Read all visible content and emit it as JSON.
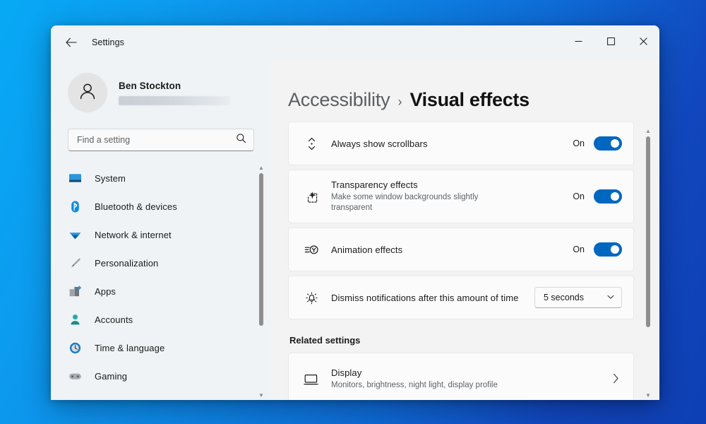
{
  "window": {
    "title": "Settings",
    "back_icon": "back-arrow-icon",
    "controls": {
      "minimize": "minimize-icon",
      "maximize": "maximize-icon",
      "close": "close-icon"
    }
  },
  "sidebar": {
    "profile": {
      "name": "Ben Stockton",
      "email_redacted": true,
      "avatar_icon": "person-icon"
    },
    "search": {
      "placeholder": "Find a setting",
      "value": "",
      "icon": "search-icon"
    },
    "items": [
      {
        "label": "System",
        "icon": "monitor-icon"
      },
      {
        "label": "Bluetooth & devices",
        "icon": "bluetooth-icon"
      },
      {
        "label": "Network & internet",
        "icon": "wifi-icon"
      },
      {
        "label": "Personalization",
        "icon": "paintbrush-icon"
      },
      {
        "label": "Apps",
        "icon": "apps-icon"
      },
      {
        "label": "Accounts",
        "icon": "account-icon"
      },
      {
        "label": "Time & language",
        "icon": "clock-icon"
      },
      {
        "label": "Gaming",
        "icon": "gamepad-icon"
      }
    ],
    "scrollbar": {
      "thumb_top_pct": 0,
      "thumb_height_pct": 70
    }
  },
  "main": {
    "breadcrumb": {
      "parent": "Accessibility",
      "separator": "›",
      "current": "Visual effects"
    },
    "settings": [
      {
        "title": "Always show scrollbars",
        "subtitle": "",
        "icon": "scrollbar-icon",
        "control": "toggle",
        "state_label": "On",
        "state": true
      },
      {
        "title": "Transparency effects",
        "subtitle": "Make some window backgrounds slightly transparent",
        "icon": "transparency-icon",
        "control": "toggle",
        "state_label": "On",
        "state": true
      },
      {
        "title": "Animation effects",
        "subtitle": "",
        "icon": "animation-icon",
        "control": "toggle",
        "state_label": "On",
        "state": true
      },
      {
        "title": "Dismiss notifications after this amount of time",
        "subtitle": "",
        "icon": "notification-bell-icon",
        "control": "dropdown",
        "value": "5 seconds",
        "chevron": "⌄"
      }
    ],
    "related": {
      "heading": "Related settings",
      "items": [
        {
          "title": "Display",
          "subtitle": "Monitors, brightness, night light, display profile",
          "icon": "monitor-icon",
          "chevron": "›"
        }
      ]
    },
    "scrollbar": {
      "thumb_top_pct": 0,
      "thumb_height_pct": 75
    }
  },
  "colors": {
    "accent": "#0067C0",
    "window_bg": "#F3F3F3",
    "sidebar_bg": "#EFF3F5",
    "card_bg": "#FBFBFB",
    "desktop_gradient_start": "#07A9F5",
    "desktop_gradient_end": "#0E3FB4"
  }
}
